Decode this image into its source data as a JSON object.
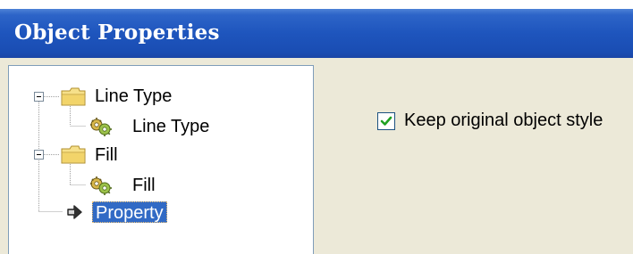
{
  "window": {
    "title": "Object Properties"
  },
  "tree": {
    "nodes": [
      {
        "label": "Line Type",
        "kind": "folder",
        "expanded": true
      },
      {
        "label": "Line Type",
        "kind": "gear-item"
      },
      {
        "label": "Fill",
        "kind": "folder",
        "expanded": true
      },
      {
        "label": "Fill",
        "kind": "gear-item"
      },
      {
        "label": "Property",
        "kind": "arrow-item",
        "selected": true
      }
    ]
  },
  "options": {
    "keep_style_label": "Keep original object style",
    "keep_style_checked": true
  },
  "colors": {
    "titlebar": "#1e55bd",
    "dialog_bg": "#ece9d8",
    "selection": "#316ac5",
    "checkmark": "#21a121",
    "folder": "#f2d46a"
  }
}
